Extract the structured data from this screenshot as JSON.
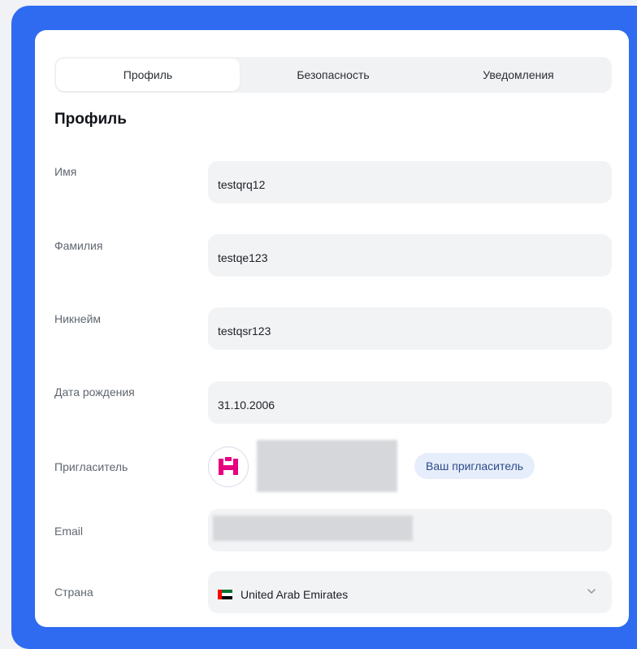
{
  "tabs": [
    {
      "label": "Профиль",
      "active": true
    },
    {
      "label": "Безопасность",
      "active": false
    },
    {
      "label": "Уведомления",
      "active": false
    }
  ],
  "section_title": "Профиль",
  "fields": {
    "first_name": {
      "label": "Имя",
      "value": "testqrq12"
    },
    "last_name": {
      "label": "Фамилия",
      "value": "testqe123"
    },
    "nickname": {
      "label": "Никнейм",
      "value": "testqsr123"
    },
    "birth_date": {
      "label": "Дата рождения",
      "value": "31.10.2006"
    },
    "inviter": {
      "label": "Пригласитель",
      "badge": "Ваш пригласитель"
    },
    "email": {
      "label": "Email"
    },
    "country": {
      "label": "Страна",
      "value": "United Arab Emirates"
    }
  },
  "colors": {
    "accent": "#2f6bf0",
    "logo_pink": "#e6007e",
    "badge_bg": "#e7eefb"
  }
}
